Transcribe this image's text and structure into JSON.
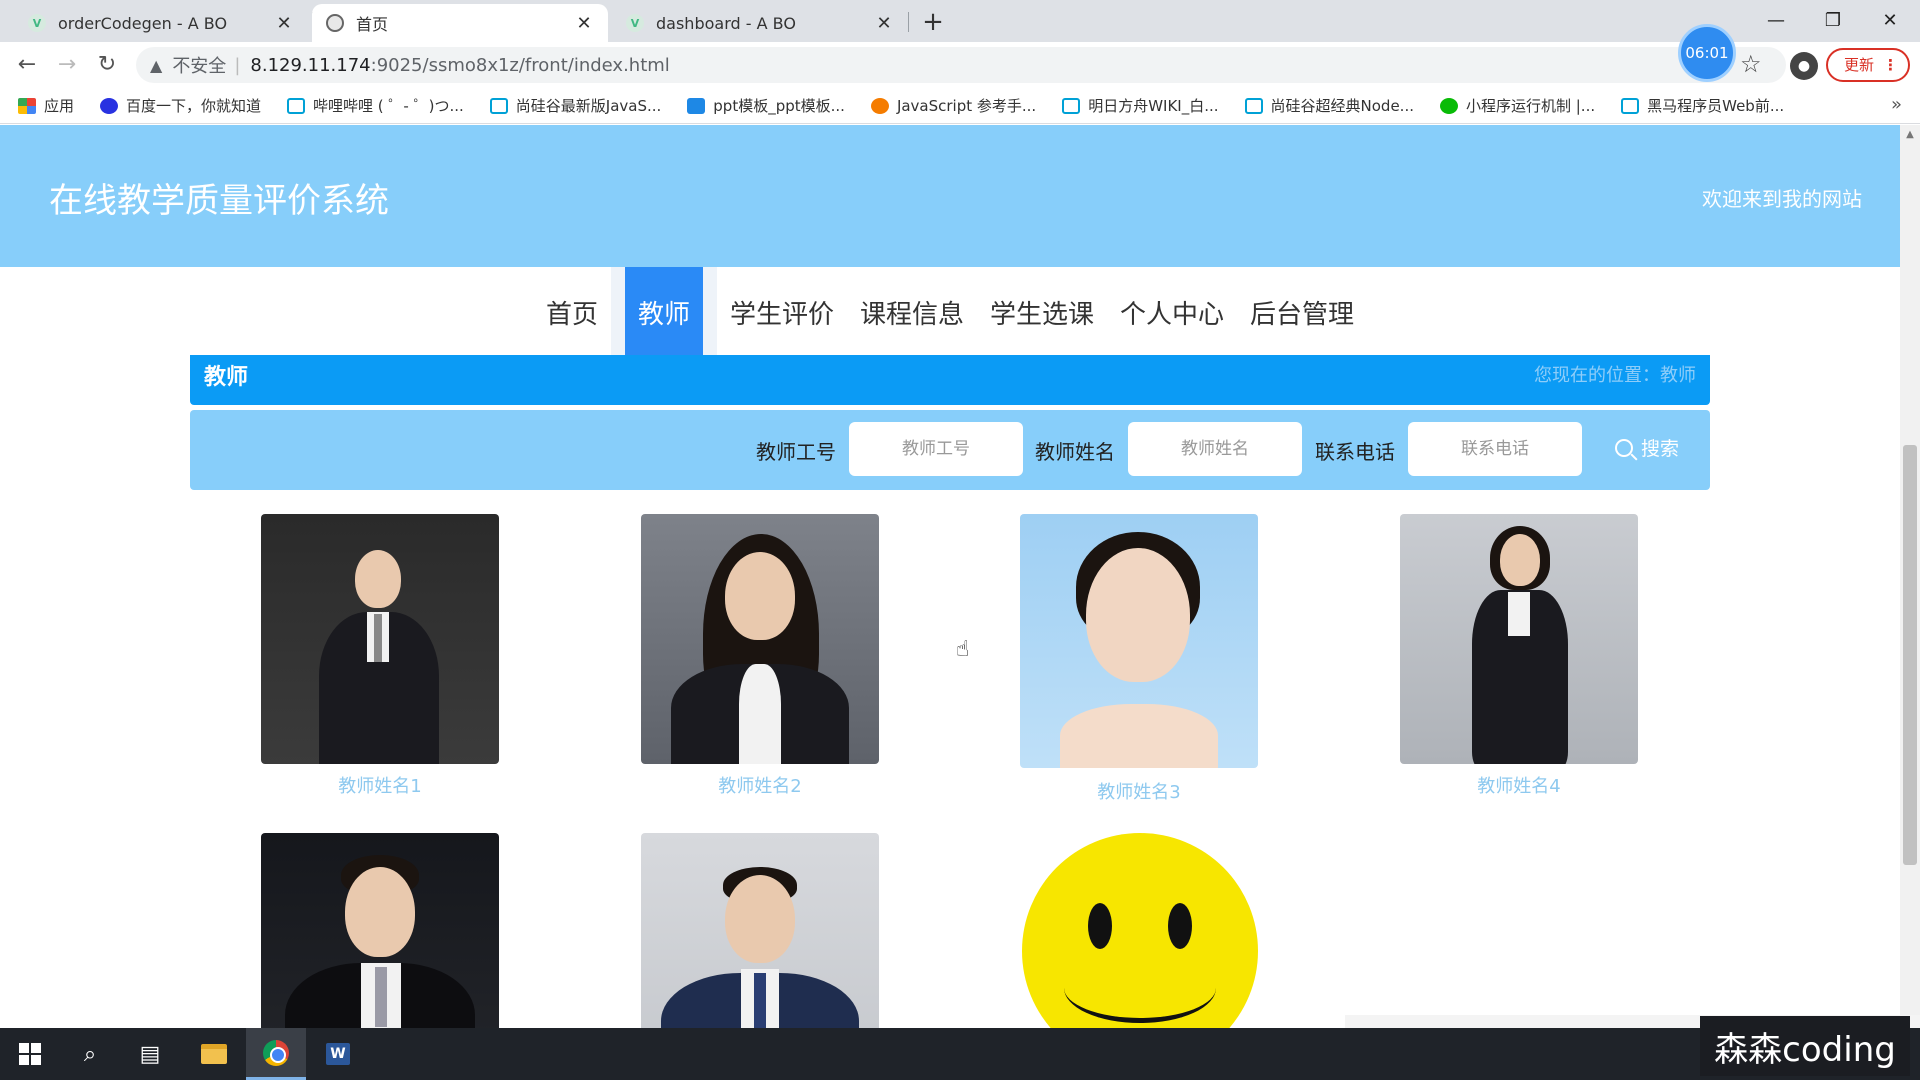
{
  "browser": {
    "tabs": [
      {
        "title": "orderCodegen - A BO",
        "icon": "vue-icon"
      },
      {
        "title": "首页",
        "icon": "globe-icon"
      },
      {
        "title": "dashboard - A BO",
        "icon": "vue-icon"
      }
    ],
    "address": {
      "security_label": "不安全",
      "host": "8.129.11.174",
      "path": ":9025/ssmo8x1z/front/index.html"
    },
    "timer": "06:01",
    "update_label": "更新",
    "bookmarks": [
      {
        "label": "应用",
        "icon": "apps-icon"
      },
      {
        "label": "百度一下，你就知道",
        "icon": "baidu-icon"
      },
      {
        "label": "哔哩哔哩 ( ゜- ゜)つ...",
        "icon": "bilibili-icon"
      },
      {
        "label": "尚硅谷最新版JavaS...",
        "icon": "bilibili-icon"
      },
      {
        "label": "ppt模板_ppt模板...",
        "icon": "ppt-icon"
      },
      {
        "label": "JavaScript 参考手...",
        "icon": "js-icon"
      },
      {
        "label": "明日方舟WIKI_白...",
        "icon": "bilibili-icon"
      },
      {
        "label": "尚硅谷超经典Node...",
        "icon": "bilibili-icon"
      },
      {
        "label": "小程序运行机制 |...",
        "icon": "wechat-icon"
      },
      {
        "label": "黑马程序员Web前...",
        "icon": "bilibili-icon"
      }
    ]
  },
  "site": {
    "title": "在线教学质量评价系统",
    "welcome": "欢迎来到我的网站"
  },
  "nav": {
    "items": [
      "首页",
      "教师",
      "学生评价",
      "课程信息",
      "学生选课",
      "个人中心",
      "后台管理"
    ],
    "active_index": 1
  },
  "breadcrumb": {
    "heading": "教师",
    "position": "您现在的位置：教师"
  },
  "search": {
    "fields": [
      {
        "label": "教师工号",
        "placeholder": "教师工号"
      },
      {
        "label": "教师姓名",
        "placeholder": "教师姓名"
      },
      {
        "label": "联系电话",
        "placeholder": "联系电话"
      }
    ],
    "button_label": "搜索"
  },
  "teachers": [
    {
      "name": "教师姓名1"
    },
    {
      "name": "教师姓名2"
    },
    {
      "name": "教师姓名3"
    },
    {
      "name": "教师姓名4"
    },
    {
      "name": ""
    },
    {
      "name": ""
    },
    {
      "name": ""
    }
  ],
  "watermark": "森森coding"
}
